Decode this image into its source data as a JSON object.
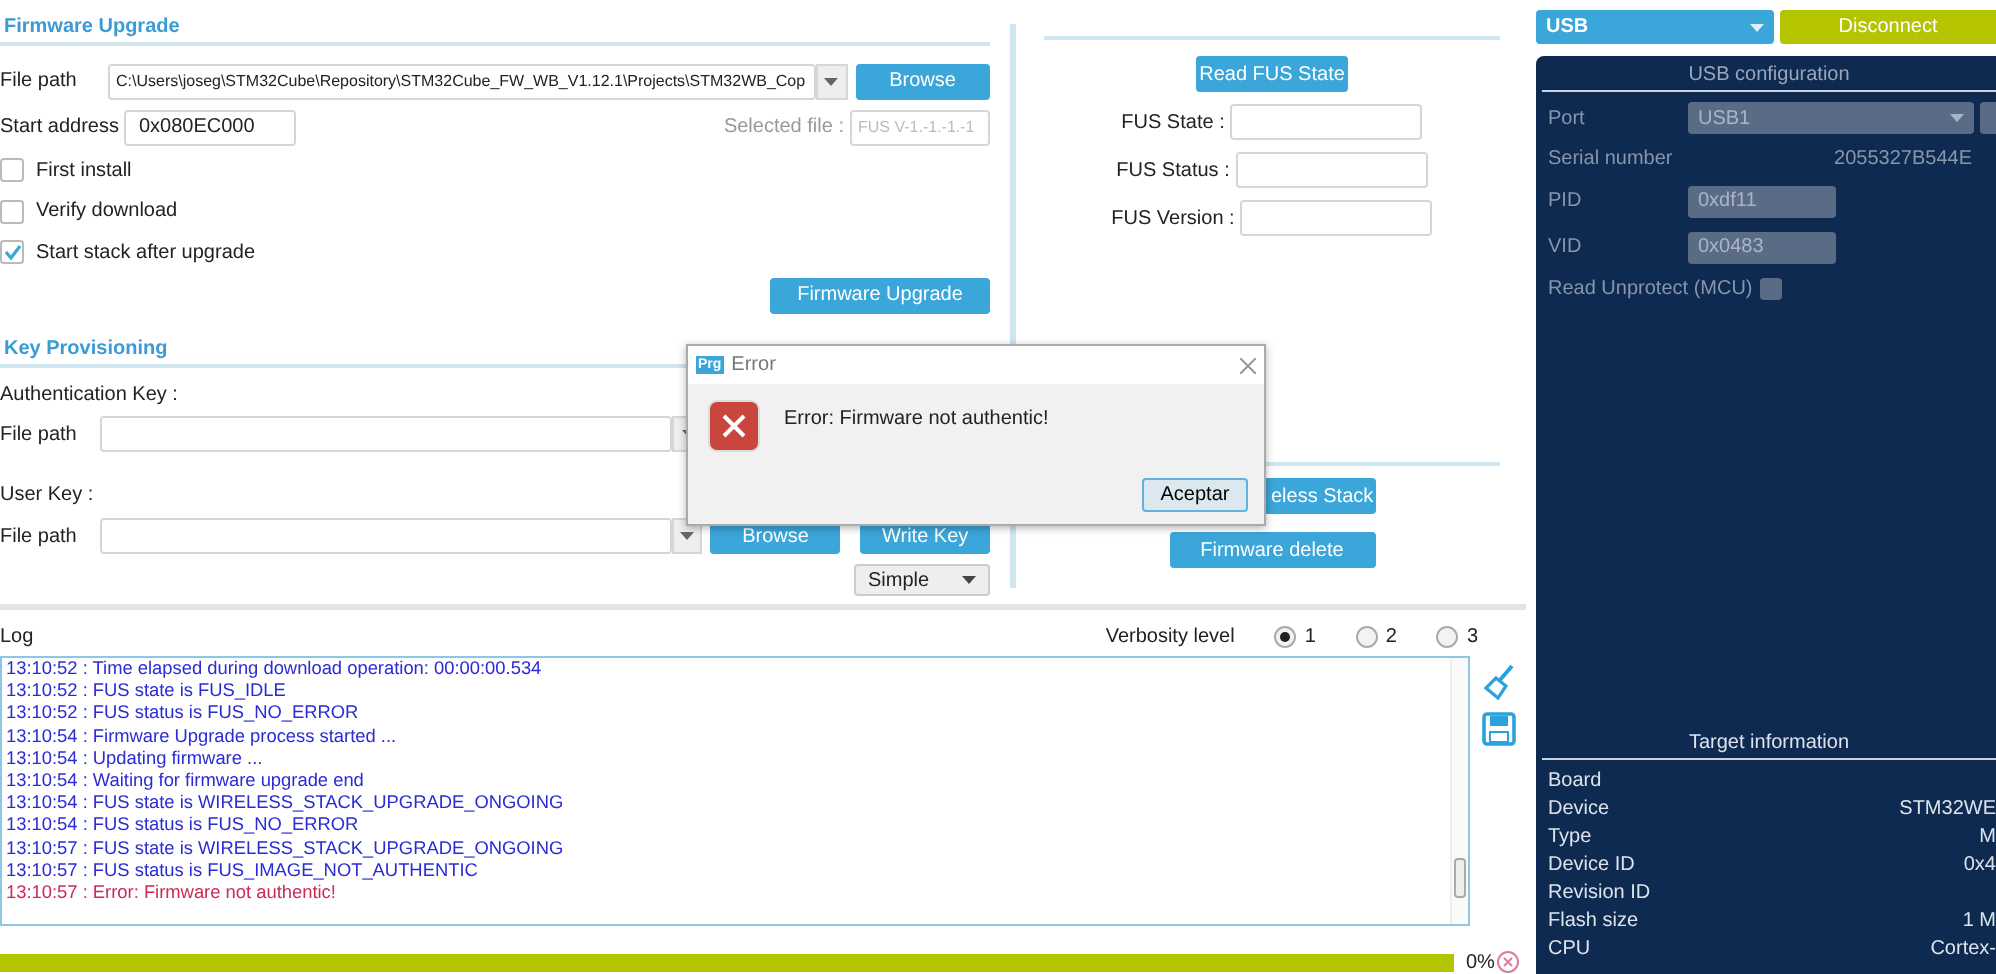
{
  "firmware_upgrade": {
    "title": "Firmware Upgrade",
    "file_path_label": "File path",
    "file_path": "C:\\Users\\joseg\\STM32Cube\\Repository\\STM32Cube_FW_WB_V1.12.1\\Projects\\STM32WB_Cop",
    "browse": "Browse",
    "start_address_label": "Start address",
    "start_address": "0x080EC000",
    "selected_file_label": "Selected file :",
    "selected_file": "FUS V-1.-1.-1.-1",
    "options": [
      {
        "label": "First install",
        "checked": false
      },
      {
        "label": "Verify download",
        "checked": false
      },
      {
        "label": "Start stack after upgrade",
        "checked": true
      }
    ],
    "upgrade_button": "Firmware Upgrade"
  },
  "key_provisioning": {
    "title": "Key Provisioning",
    "auth_key_label": "Authentication Key :",
    "auth_file_label": "File path",
    "user_key_label": "User Key :",
    "user_file_label": "File path",
    "browse": "Browse",
    "write_key": "Write Key",
    "mode": "Simple"
  },
  "fus": {
    "read_button": "Read FUS State",
    "fields": [
      {
        "label": "FUS State :"
      },
      {
        "label": "FUS Status :"
      },
      {
        "label": "FUS Version :"
      }
    ],
    "start_stack_button": "eless Stack",
    "delete_button": "Firmware delete"
  },
  "log": {
    "title": "Log",
    "verbosity_label": "Verbosity level",
    "levels": [
      {
        "label": "1",
        "selected": true
      },
      {
        "label": "2",
        "selected": false
      },
      {
        "label": "3",
        "selected": false
      }
    ],
    "lines": [
      {
        "text": "13:10:52 : Time elapsed during download operation: 00:00:00.534",
        "kind": "info"
      },
      {
        "text": "13:10:52 : FUS state is FUS_IDLE",
        "kind": "info"
      },
      {
        "text": "13:10:52 : FUS status is FUS_NO_ERROR",
        "kind": "info"
      },
      {
        "text": "13:10:54 : Firmware Upgrade process started ...",
        "kind": "info"
      },
      {
        "text": "13:10:54 : Updating firmware ...",
        "kind": "info"
      },
      {
        "text": "13:10:54 : Waiting for firmware upgrade end",
        "kind": "info"
      },
      {
        "text": "13:10:54 : FUS state is WIRELESS_STACK_UPGRADE_ONGOING",
        "kind": "info"
      },
      {
        "text": "13:10:54 : FUS status is FUS_NO_ERROR",
        "kind": "info"
      },
      {
        "text": "13:10:57 : FUS state is WIRELESS_STACK_UPGRADE_ONGOING",
        "kind": "info"
      },
      {
        "text": "13:10:57 : FUS status is FUS_IMAGE_NOT_AUTHENTIC",
        "kind": "info"
      },
      {
        "text": "13:10:57 : Error: Firmware not authentic!",
        "kind": "error"
      }
    ]
  },
  "progress": {
    "level": 1,
    "reading": "0%"
  },
  "connection": {
    "interface": "USB",
    "disconnect": "Disconnect"
  },
  "usb_config": {
    "title": "USB configuration",
    "port_label": "Port",
    "port": "USB1",
    "serial_label": "Serial number",
    "serial": "2055327B544E",
    "pid_label": "PID",
    "pid": "0xdf11",
    "vid_label": "VID",
    "vid": "0x0483",
    "read_unprotect_label": "Read Unprotect (MCU)",
    "read_unprotect_checked": false
  },
  "target": {
    "title": "Target information",
    "rows": [
      {
        "label": "Board"
      },
      {
        "label": "Device",
        "value": "STM32WE"
      },
      {
        "label": "Type",
        "value": "M"
      },
      {
        "label": "Device ID",
        "value": "0x4"
      },
      {
        "label": "Revision ID"
      },
      {
        "label": "Flash size",
        "value": "1 M"
      },
      {
        "label": "CPU",
        "value": "Cortex-"
      }
    ]
  },
  "dialog": {
    "badge": "Prg",
    "title": "Error",
    "message": "Error: Firmware not authentic!",
    "ok": "Aceptar"
  }
}
